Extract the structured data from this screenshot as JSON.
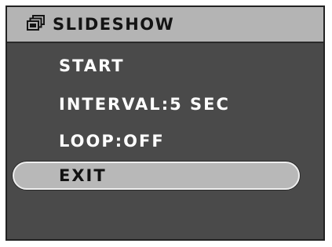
{
  "menu": {
    "title": "SLIDESHOW",
    "title_icon": "slideshow-stacked-frames-icon",
    "items": [
      {
        "label": "START",
        "selected": false
      },
      {
        "label": "INTERVAL:5 SEC",
        "selected": false
      },
      {
        "label": "LOOP:OFF",
        "selected": false
      },
      {
        "label": "EXIT",
        "selected": true
      }
    ]
  },
  "colors": {
    "background": "#4a4a4a",
    "title_bar": "#b4b4b4",
    "selection": "#b8b8b8",
    "text": "#ffffff",
    "selected_text": "#121212"
  }
}
